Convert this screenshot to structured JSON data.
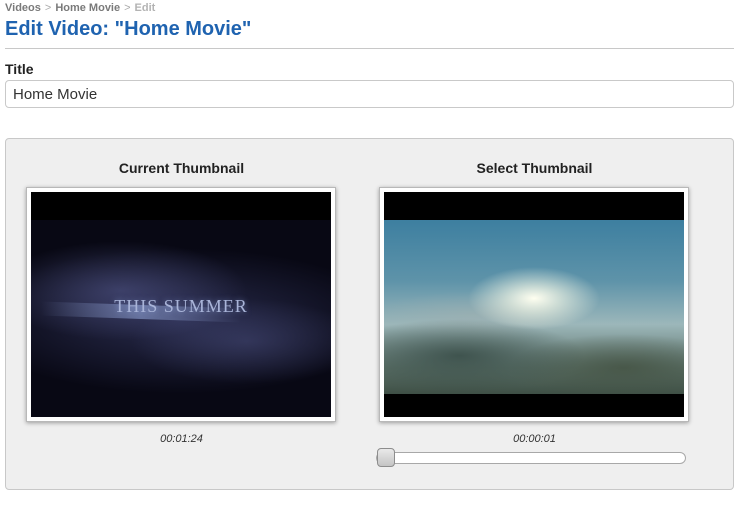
{
  "breadcrumb": {
    "items": [
      "Videos",
      "Home Movie",
      "Edit"
    ],
    "separator": ">"
  },
  "page": {
    "title": "Edit Video: \"Home Movie\""
  },
  "form": {
    "title_label": "Title",
    "title_value": "Home Movie"
  },
  "current_thumbnail": {
    "heading": "Current Thumbnail",
    "overlay_text": "THIS SUMMER",
    "timecode": "00:01:24"
  },
  "select_thumbnail": {
    "heading": "Select Thumbnail",
    "timecode": "00:00:01",
    "slider_position": 0
  },
  "colors": {
    "title_blue": "#1f63b0",
    "breadcrumb_gray": "#8a8a8a",
    "panel_bg": "#efefef"
  }
}
